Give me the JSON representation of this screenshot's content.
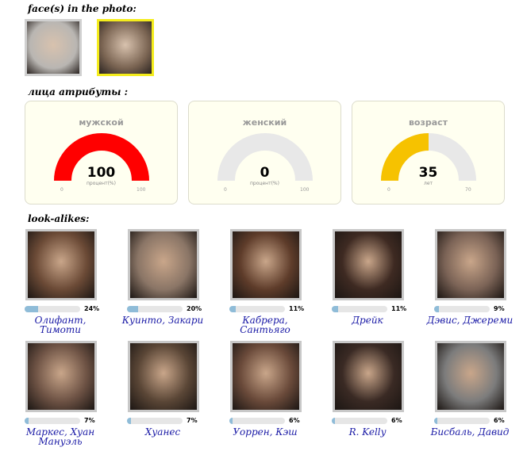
{
  "faces_section": {
    "title": "face(s) in the photo:",
    "faces": [
      {
        "label": "cat face",
        "selected": false,
        "color": "#b9b6b2"
      },
      {
        "label": "man face",
        "selected": true,
        "color": "#7a6452"
      }
    ]
  },
  "attributes_section": {
    "title": "лица атрибуты :",
    "gauges": [
      {
        "title": "мужской",
        "value": "100",
        "fraction": 1.0,
        "unit": "процент(%)",
        "min": "0",
        "max": "100",
        "color": "#ff0000"
      },
      {
        "title": "женский",
        "value": "0",
        "fraction": 0.0,
        "unit": "процент(%)",
        "min": "0",
        "max": "100",
        "color": "#ff0000"
      },
      {
        "title": "возраст",
        "value": "35",
        "fraction": 0.5,
        "unit": "лет",
        "min": "0",
        "max": "70",
        "color": "#f6c200"
      }
    ],
    "track_color": "#e8e8e8"
  },
  "lookalikes_section": {
    "title": "look-alikes:",
    "items": [
      {
        "name": "Олифант, Тимоти",
        "percent_label": "24%",
        "fraction": 0.24,
        "color": "#6b4a36"
      },
      {
        "name": "Куинто, Закари",
        "percent_label": "20%",
        "fraction": 0.2,
        "color": "#8a7566"
      },
      {
        "name": "Кабрера, Сантьяго",
        "percent_label": "11%",
        "fraction": 0.11,
        "color": "#5e3c2a"
      },
      {
        "name": "Дрейк",
        "percent_label": "11%",
        "fraction": 0.11,
        "color": "#3e2a22"
      },
      {
        "name": "Дэвис, Джереми",
        "percent_label": "9%",
        "fraction": 0.09,
        "color": "#7b6356"
      },
      {
        "name": "Маркес, Хуан Мануэль",
        "percent_label": "7%",
        "fraction": 0.07,
        "color": "#6d5244"
      },
      {
        "name": "Хуанес",
        "percent_label": "7%",
        "fraction": 0.07,
        "color": "#5a4636"
      },
      {
        "name": "Уоррен, Кэш",
        "percent_label": "6%",
        "fraction": 0.06,
        "color": "#6a4a3a"
      },
      {
        "name": "R. Kelly",
        "percent_label": "6%",
        "fraction": 0.06,
        "color": "#3a2a24"
      },
      {
        "name": "Бисбаль, Давид",
        "percent_label": "6%",
        "fraction": 0.06,
        "color": "#7c7c7c"
      }
    ]
  }
}
